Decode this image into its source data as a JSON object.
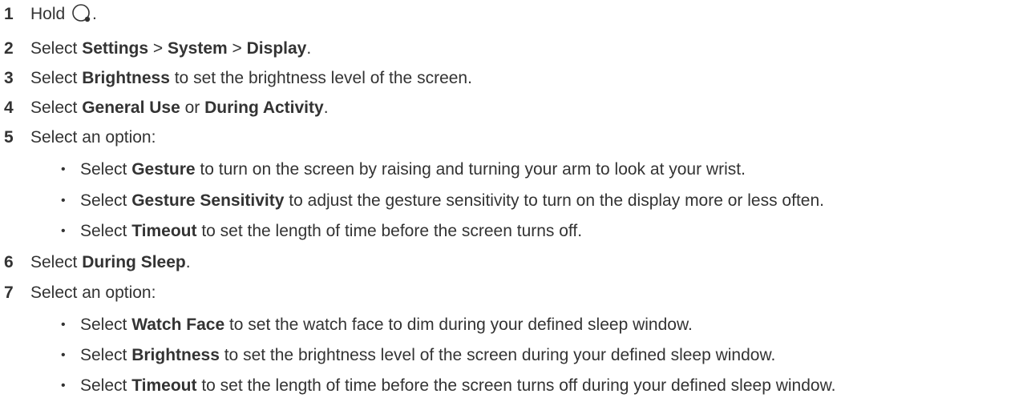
{
  "steps": [
    {
      "num": "1",
      "text": "Hold",
      "icon": "watch-button-icon",
      "after": "."
    },
    {
      "num": "2",
      "pre": "Select ",
      "b1": "Settings",
      "mid1": " > ",
      "b2": "System",
      "mid2": " > ",
      "b3": "Display",
      "post": "."
    },
    {
      "num": "3",
      "pre": "Select ",
      "b1": "Brightness",
      "post": " to set the brightness level of the screen."
    },
    {
      "num": "4",
      "pre": "Select ",
      "b1": "General Use",
      "mid1": " or ",
      "b2": "During Activity",
      "post": "."
    },
    {
      "num": "5",
      "text": "Select an option:"
    },
    {
      "num": "6",
      "pre": "Select ",
      "b1": "During Sleep",
      "post": "."
    },
    {
      "num": "7",
      "text": "Select an option:"
    }
  ],
  "bullets_5": [
    {
      "pre": "Select ",
      "b": "Gesture",
      "post": " to turn on the screen by raising and turning your arm to look at your wrist."
    },
    {
      "pre": "Select ",
      "b": "Gesture Sensitivity",
      "post": " to adjust the gesture sensitivity to turn on the display more or less often."
    },
    {
      "pre": "Select ",
      "b": "Timeout",
      "post": " to set the length of time before the screen turns off."
    }
  ],
  "bullets_7": [
    {
      "pre": "Select ",
      "b": "Watch Face",
      "post": " to set the watch face to dim during your defined sleep window."
    },
    {
      "pre": "Select ",
      "b": "Brightness",
      "post": " to set the brightness level of the screen during your defined sleep window."
    },
    {
      "pre": "Select ",
      "b": "Timeout",
      "post": " to set the length of time before the screen turns off during your defined sleep window."
    }
  ],
  "bullet_glyph": "•"
}
